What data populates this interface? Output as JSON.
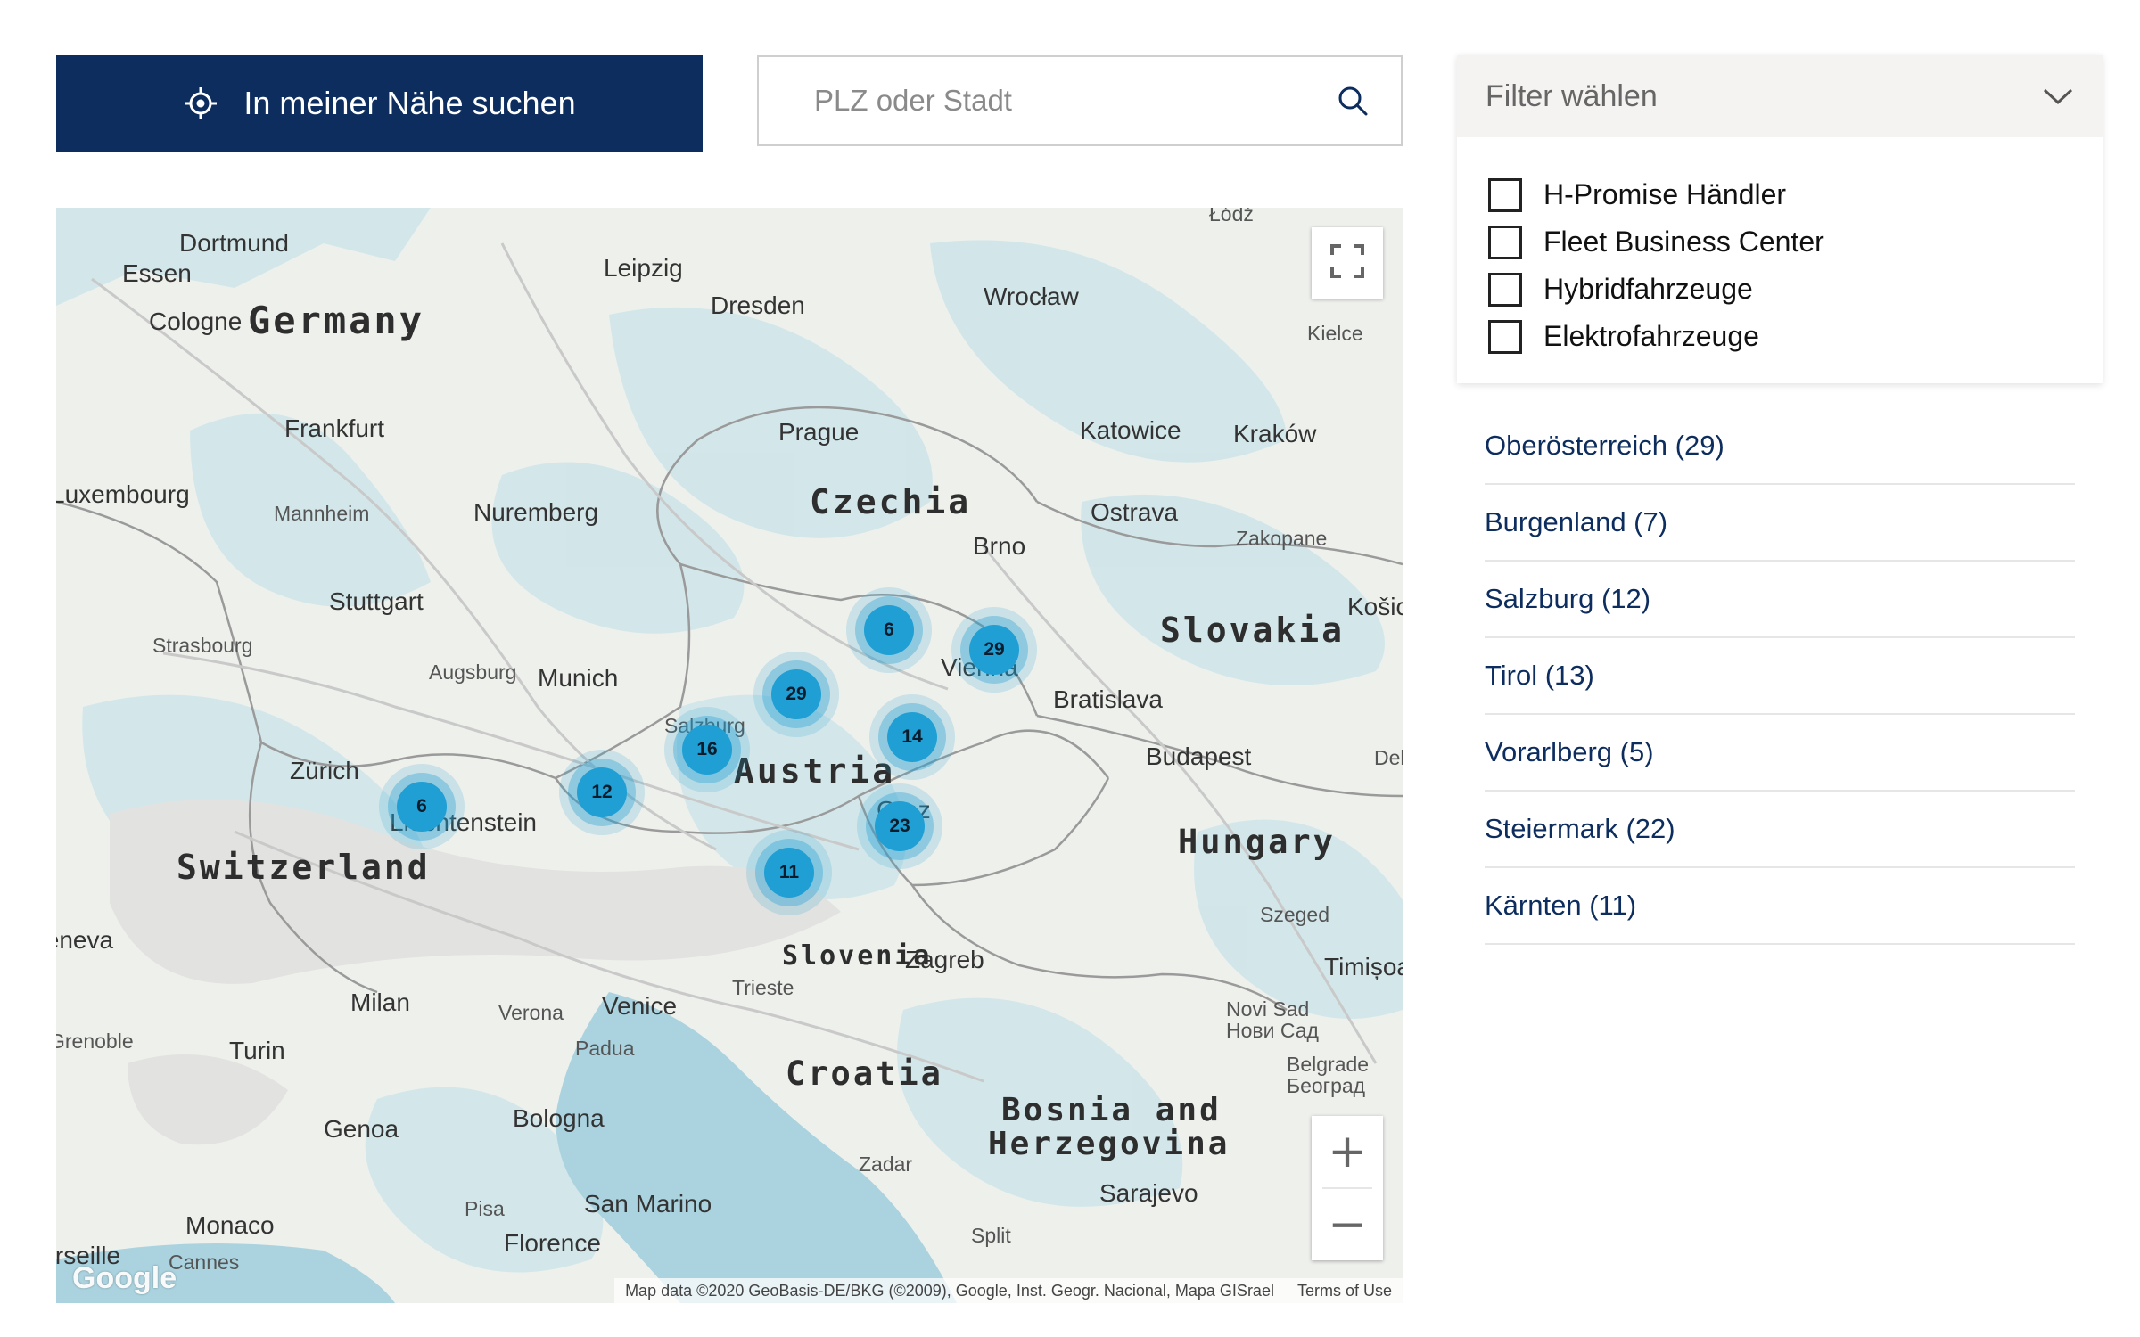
{
  "locate_button": {
    "label": "In meiner Nähe suchen",
    "icon": "crosshair-icon"
  },
  "search": {
    "placeholder": "PLZ oder Stadt",
    "value": "",
    "icon": "search-icon"
  },
  "filter": {
    "title": "Filter wählen",
    "icon": "chevron-down-icon",
    "options": [
      {
        "label": "H-Promise Händler",
        "checked": false
      },
      {
        "label": "Fleet Business Center",
        "checked": false
      },
      {
        "label": "Hybridfahrzeuge",
        "checked": false
      },
      {
        "label": "Elektrofahrzeuge",
        "checked": false
      }
    ]
  },
  "regions": [
    "Oberösterreich (29)",
    "Burgenland (7)",
    "Salzburg (12)",
    "Tirol (13)",
    "Vorarlberg (5)",
    "Steiermark (22)",
    "Kärnten (11)"
  ],
  "map": {
    "countries": [
      "Germany",
      "Czechia",
      "Slovakia",
      "Austria",
      "Switzerland",
      "Hungary",
      "Slovenia",
      "Croatia",
      "Bosnia and",
      "Herzegovina"
    ],
    "cities": [
      "Dortmund",
      "Essen",
      "Cologne",
      "Leipzig",
      "Dresden",
      "Wrocław",
      "Kielce",
      "Łódź",
      "Frankfurt",
      "Prague",
      "Katowice",
      "Kraków",
      "Luxembourg",
      "Mannheim",
      "Nuremberg",
      "Ostrava",
      "Zakopane",
      "Brno",
      "Stuttgart",
      "Strasbourg",
      "Augsburg",
      "Munich",
      "Salzburg",
      "Vienna",
      "Bratislava",
      "Košice",
      "Zürich",
      "Liechtenstein",
      "Budapest",
      "Debrecen",
      "Graz",
      "Geneva",
      "Szeged",
      "Trieste",
      "Zagreb",
      "Timișoara",
      "Milan",
      "Verona",
      "Venice",
      "Padua",
      "Novi Sad",
      "Нови Сад",
      "Grenoble",
      "Turin",
      "Belgrade",
      "Београд",
      "Genoa",
      "Bologna",
      "Zadar",
      "Sarajevo",
      "Monaco",
      "Pisa",
      "San Marino",
      "Florence",
      "Split",
      "Marseille",
      "Cannes"
    ],
    "clusters": [
      6,
      29,
      29,
      16,
      14,
      12,
      6,
      23,
      11
    ],
    "fullscreen_icon": "fullscreen-icon",
    "zoom_in": "+",
    "zoom_out": "−",
    "attribution": "Map data ©2020 GeoBasis-DE/BKG (©2009), Google, Inst. Geogr. Nacional, Mapa GISrael",
    "terms": "Terms of Use",
    "logo": "Google",
    "accent_color": "#1f9fd3",
    "button_color": "#0d2d5e"
  }
}
